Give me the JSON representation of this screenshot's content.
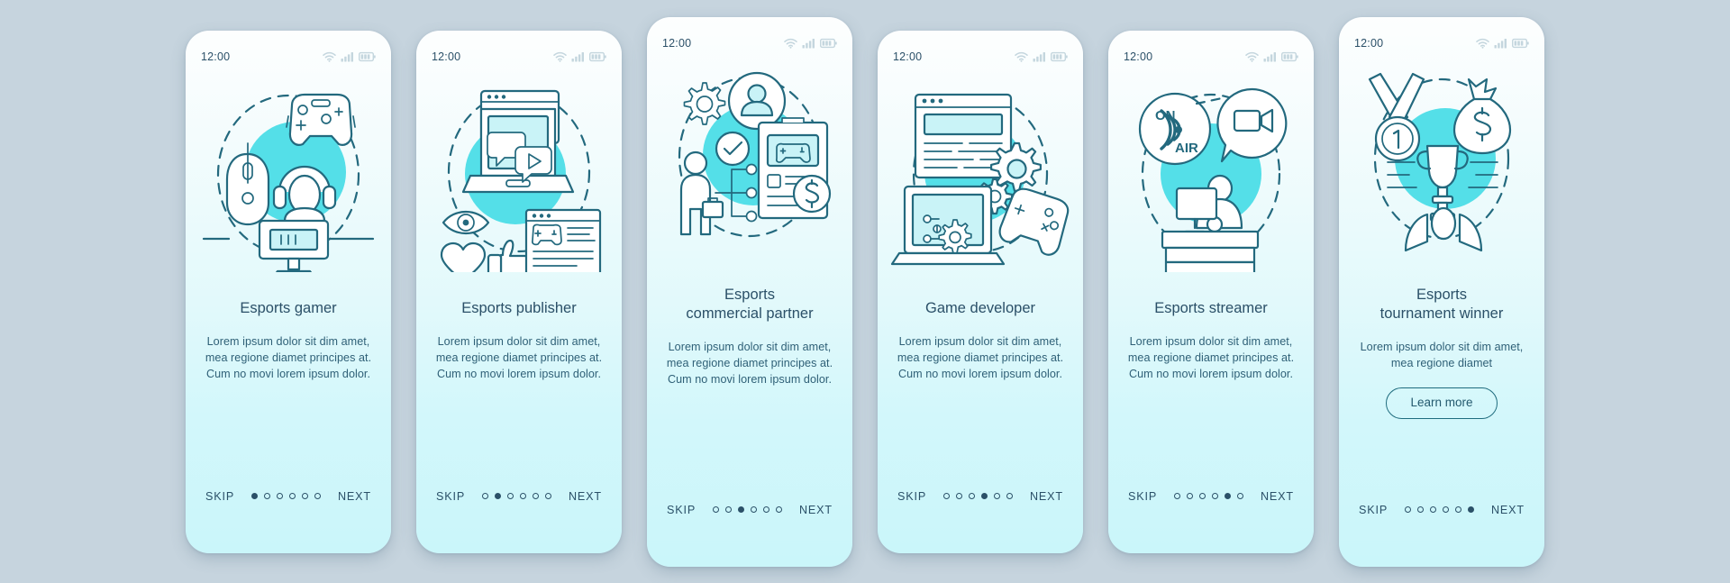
{
  "background_color": "#c6d4de",
  "accent_color": "#54dfe8",
  "stroke_color": "#23697e",
  "text_color": "#2b5068",
  "status_bar": {
    "time": "12:00",
    "icons": [
      "wifi-icon",
      "cellular-signal-icon",
      "battery-icon"
    ]
  },
  "nav": {
    "skip_label": "SKIP",
    "next_label": "NEXT",
    "total_dots": 6
  },
  "screens": [
    {
      "id": "esports-gamer",
      "title": "Esports gamer",
      "description": "Lorem ipsum dolor sit dim amet, mea regione diamet principes at. Cum no movi lorem ipsum dolor.",
      "active_dot": 1,
      "illustration": "gamer-gear-icon",
      "cta": null
    },
    {
      "id": "esports-publisher",
      "title": "Esports publisher",
      "description": "Lorem ipsum dolor sit dim amet, mea regione diamet principes at. Cum no movi lorem ipsum dolor.",
      "active_dot": 2,
      "illustration": "laptop-media-icon",
      "cta": null
    },
    {
      "id": "esports-commercial-partner",
      "title": "Esports\ncommercial partner",
      "description": "Lorem ipsum dolor sit dim amet, mea regione diamet principes at. Cum no movi lorem ipsum dolor.",
      "active_dot": 3,
      "illustration": "partner-contract-icon",
      "cta": null
    },
    {
      "id": "game-developer",
      "title": "Game developer",
      "description": "Lorem ipsum dolor sit dim amet, mea regione diamet principes at. Cum no movi lorem ipsum dolor.",
      "active_dot": 4,
      "illustration": "developer-gears-icon",
      "cta": null
    },
    {
      "id": "esports-streamer",
      "title": "Esports streamer",
      "description": "Lorem ipsum dolor sit dim amet, mea regione diamet principes at. Cum no movi lorem ipsum dolor.",
      "active_dot": 5,
      "illustration": "on-air-stream-icon",
      "cta": null
    },
    {
      "id": "esports-tournament-winner",
      "title": "Esports\ntournament winner",
      "description": "Lorem ipsum dolor sit dim amet, mea regione diamet",
      "active_dot": 6,
      "illustration": "trophy-prize-icon",
      "cta": "Learn more"
    }
  ]
}
